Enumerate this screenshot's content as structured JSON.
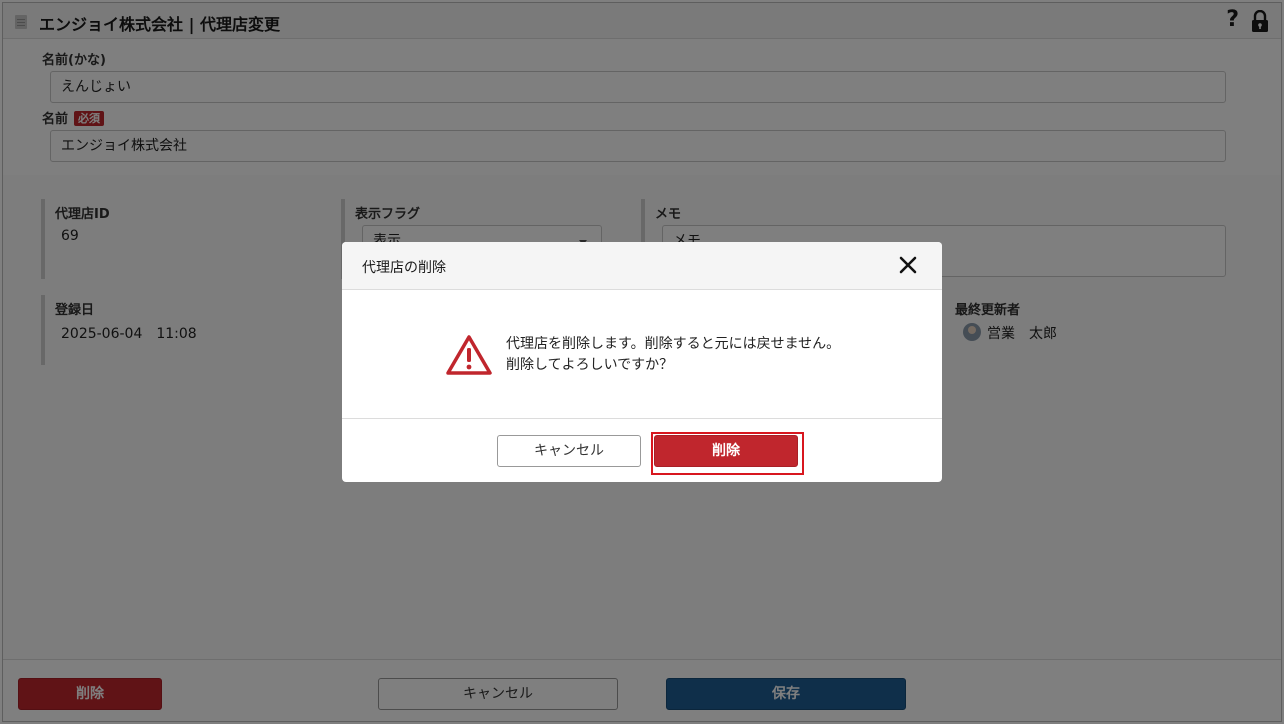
{
  "window": {
    "title": "エンジョイ株式会社 | 代理店変更",
    "help_icon": "help-icon",
    "lock_icon": "lock-icon"
  },
  "form": {
    "kana_label": "名前(かな)",
    "kana_value": "えんじょい",
    "name_label": "名前",
    "required_badge": "必須",
    "name_value": "エンジョイ株式会社"
  },
  "details": {
    "agency_id_label": "代理店ID",
    "agency_id_value": "69",
    "display_flag_label": "表示フラグ",
    "display_flag_value": "表示",
    "memo_label": "メモ",
    "memo_value": "メモ",
    "registered_label": "登録日",
    "registered_value": "2025-06-04　11:08",
    "last_updater_label": "最終更新者",
    "last_updater_value": "営業　太郎"
  },
  "footer": {
    "delete_label": "削除",
    "cancel_label": "キャンセル",
    "save_label": "保存"
  },
  "dialog": {
    "title": "代理店の削除",
    "message_line1": "代理店を削除します。削除すると元には戻せません。",
    "message_line2": "削除してよろしいですか？",
    "cancel_label": "キャンセル",
    "delete_label": "削除"
  },
  "colors": {
    "danger": "#c0262d",
    "primary": "#1f5f95",
    "focus_ring": "#d8171f"
  }
}
